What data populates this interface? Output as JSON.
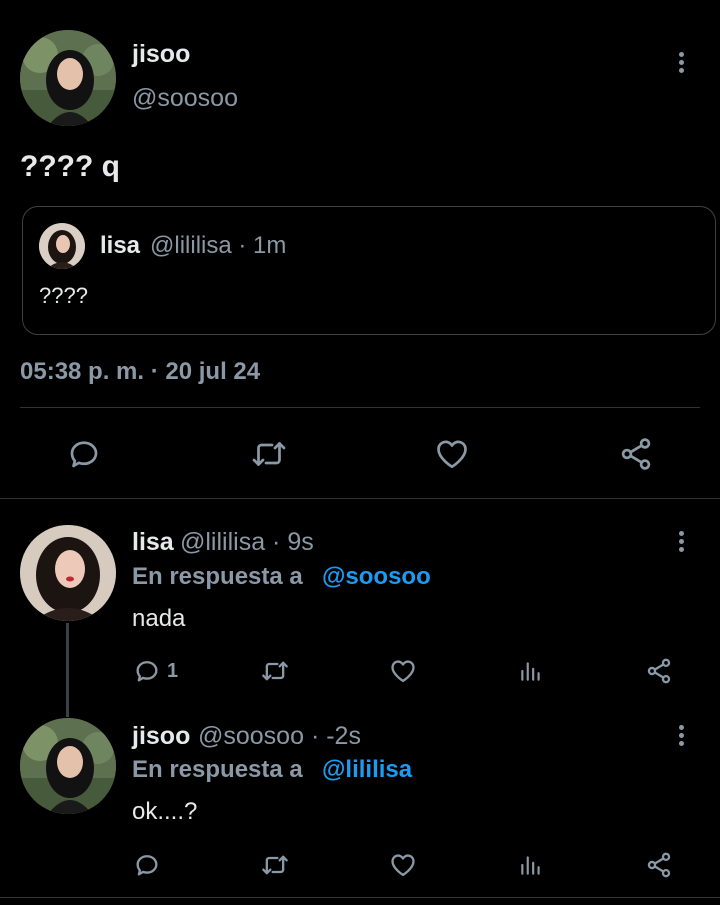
{
  "main_tweet": {
    "name": "jisoo",
    "handle": "@soosoo",
    "text": "???? q",
    "quote": {
      "name": "lisa",
      "meta": "@lililisa · 1m",
      "text": "????"
    },
    "timestamp": "05:38 p. m. · 20 jul 24",
    "actions": {
      "reply_icon": "speech-bubble",
      "retweet_icon": "retweet-arrows",
      "like_icon": "heart",
      "share_icon": "share-nodes"
    }
  },
  "replies": [
    {
      "name": "lisa",
      "meta": "@lililisa · 9s",
      "reply_prefix": "En respuesta a",
      "reply_to": "@soosoo",
      "text": "nada",
      "reply_count": "1"
    },
    {
      "name": "jisoo",
      "meta": "@soosoo · -2s",
      "reply_prefix": "En respuesta a",
      "reply_to": "@lililisa",
      "text": "ok....?",
      "reply_count": ""
    }
  ],
  "colors": {
    "background": "#000000",
    "text": "#e7e9ea",
    "muted": "#8b98a5",
    "link": "#1d9bf0",
    "border": "#2f3336"
  }
}
